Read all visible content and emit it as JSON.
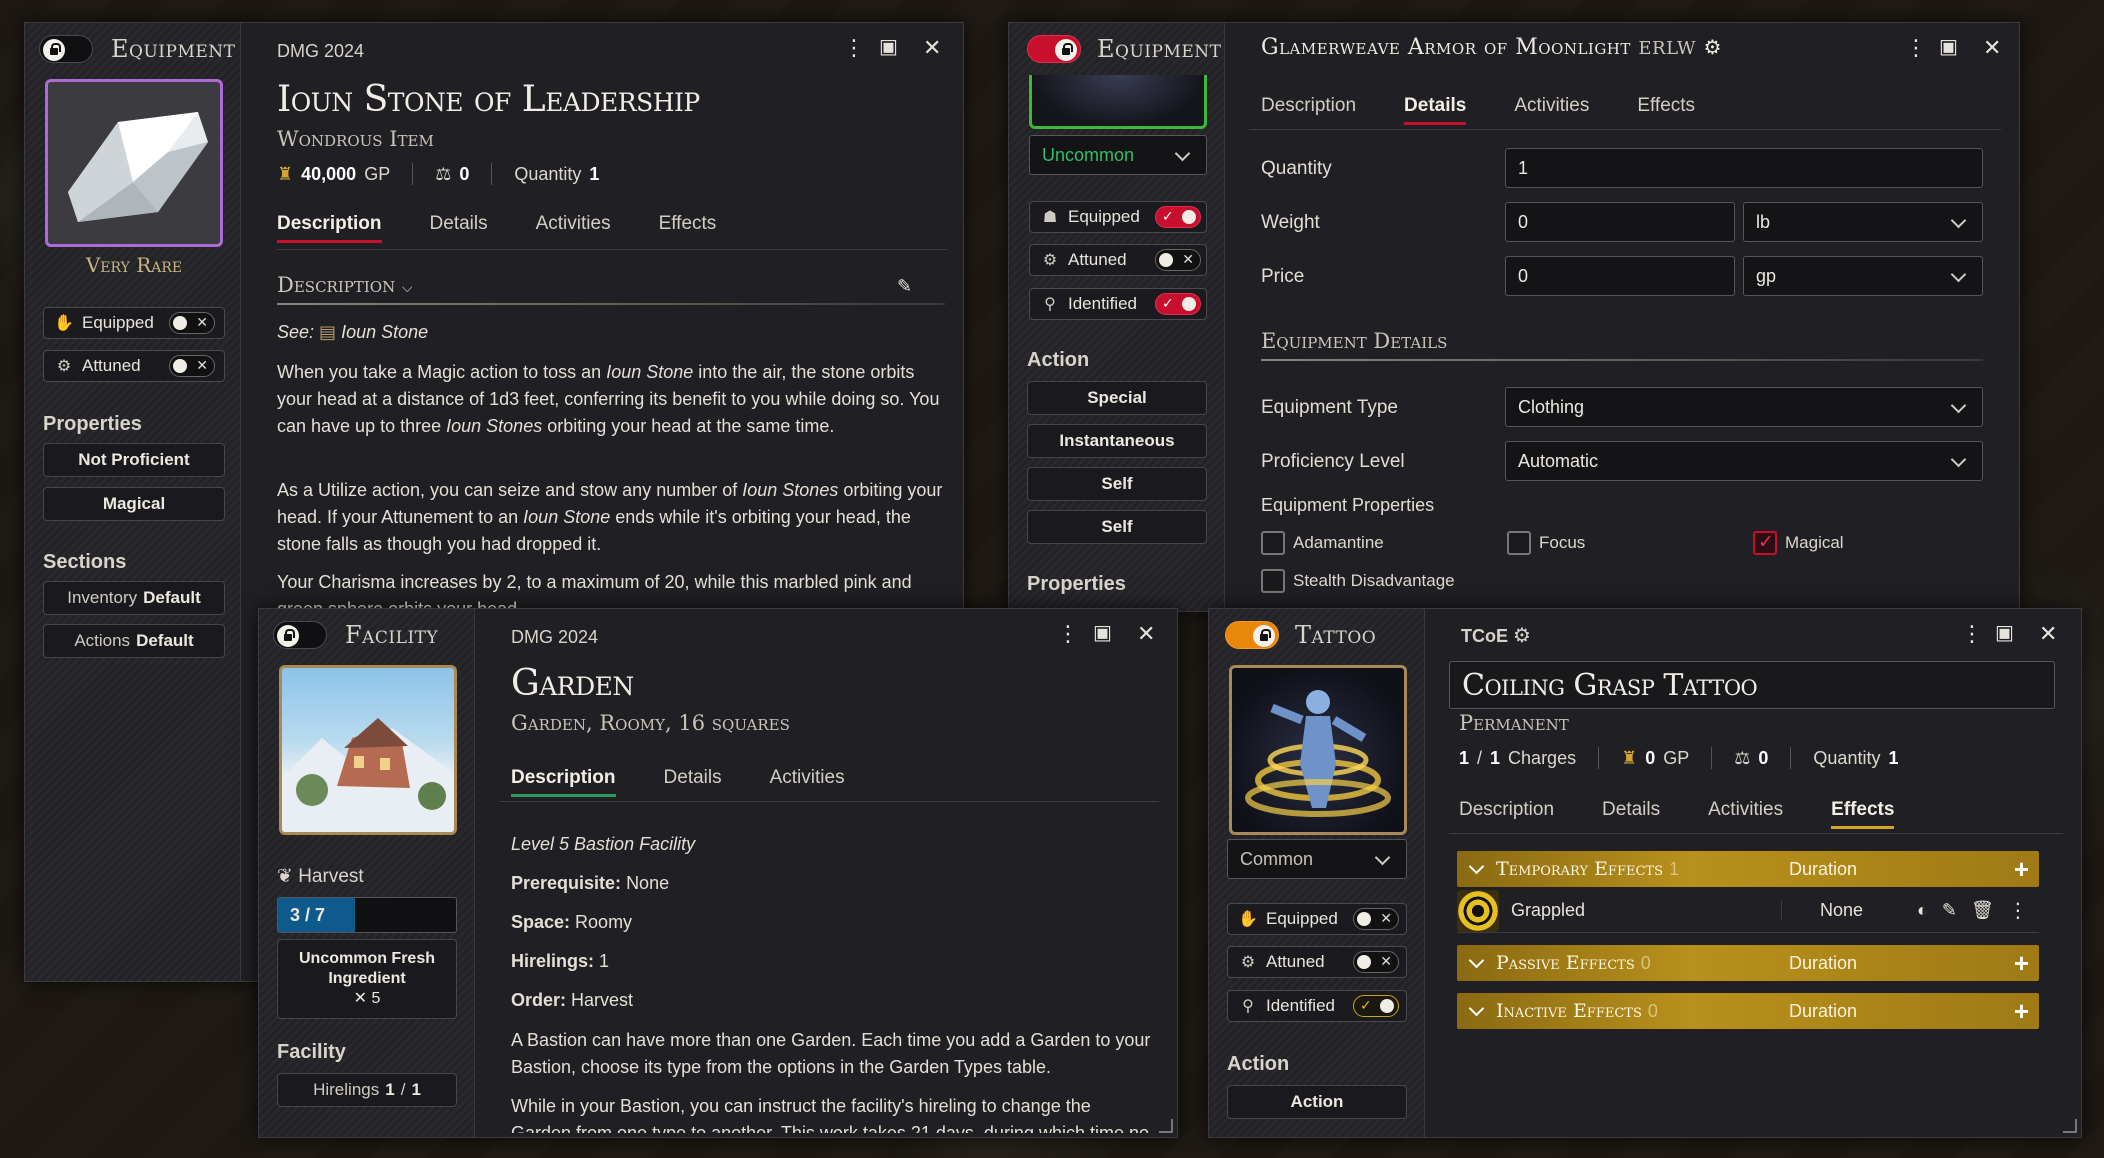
{
  "win1": {
    "type_label": "Equipment",
    "source": "DMG 2024",
    "title": "Ioun Stone of Leadership",
    "subtitle": "Wondrous Item",
    "price": "40,000",
    "price_unit": "GP",
    "weight": "0",
    "quantity_label": "Quantity",
    "quantity": "1",
    "rarity": "Very Rare",
    "equipped_label": "Equipped",
    "attuned_label": "Attuned",
    "properties_heading": "Properties",
    "properties": [
      "Not Proficient",
      "Magical"
    ],
    "sections_heading": "Sections",
    "sections": [
      {
        "name": "Inventory",
        "value": "Default"
      },
      {
        "name": "Actions",
        "value": "Default"
      }
    ],
    "tabs": [
      "Description",
      "Details",
      "Activities",
      "Effects"
    ],
    "active_tab": "Description",
    "desc_heading": "Description",
    "see_label": "See:",
    "see_link": "Ioun Stone",
    "paragraphs": {
      "p1a": "When you take a Magic action to toss an ",
      "p1b": "Ioun Stone",
      "p1c": " into the air, the stone orbits your head at a distance of 1d3 feet, conferring its benefit to you while doing so. You can have up to three ",
      "p1d": "Ioun Stones",
      "p1e": " orbiting your head at the same time.",
      "p2a": "As a Utilize action, you can seize and stow any number of ",
      "p2b": "Ioun Stones",
      "p2c": " orbiting your head. If your Attunement to an ",
      "p2d": "Ioun Stone",
      "p2e": " ends while it's orbiting your head, the stone falls as though you had dropped it.",
      "p3": "Your Charisma increases by 2, to a maximum of 20, while this marbled pink and green sphere orbits your head."
    }
  },
  "win2": {
    "type_label": "Equipment",
    "title": "Glamerweave Armor of Moonlight",
    "source": "ERLW",
    "rarity_select": "Uncommon",
    "equipped_label": "Equipped",
    "attuned_label": "Attuned",
    "identified_label": "Identified",
    "action_heading": "Action",
    "action_buttons": [
      "Special",
      "Instantaneous",
      "Self",
      "Self"
    ],
    "properties_heading": "Properties",
    "tabs": [
      "Description",
      "Details",
      "Activities",
      "Effects"
    ],
    "active_tab": "Details",
    "quantity_label": "Quantity",
    "quantity": "1",
    "weight_label": "Weight",
    "weight": "0",
    "weight_unit": "lb",
    "price_label": "Price",
    "price": "0",
    "price_unit": "gp",
    "details_heading": "Equipment Details",
    "equip_type_label": "Equipment Type",
    "equip_type": "Clothing",
    "prof_label": "Proficiency Level",
    "prof": "Automatic",
    "equip_props_label": "Equipment Properties",
    "checkboxes": [
      {
        "label": "Adamantine",
        "checked": false
      },
      {
        "label": "Focus",
        "checked": false
      },
      {
        "label": "Magical",
        "checked": true
      },
      {
        "label": "Stealth Disadvantage",
        "checked": false
      }
    ]
  },
  "win3": {
    "type_label": "Facility",
    "source": "DMG 2024",
    "title": "Garden",
    "subtitle": "Garden, Roomy, 16 squares",
    "harvest_label": "Harvest",
    "harvest_value": "3 / 7",
    "harvest_fraction": 0.43,
    "ingredient": "Uncommon Fresh Ingredient",
    "ingredient_qty": "✕ 5",
    "facility_heading": "Facility",
    "hirelings_label": "Hirelings",
    "hirelings_value": "1",
    "hirelings_max": "1",
    "tabs": [
      "Description",
      "Details",
      "Activities"
    ],
    "active_tab": "Description",
    "level": "Level 5 Bastion Facility",
    "facts": [
      {
        "k": "Prerequisite:",
        "v": "None"
      },
      {
        "k": "Space:",
        "v": "Roomy"
      },
      {
        "k": "Hirelings:",
        "v": "1"
      },
      {
        "k": "Order:",
        "v": "Harvest"
      }
    ],
    "para1": "A Bastion can have more than one Garden. Each time you add a Garden to your Bastion, choose its type from the options in the Garden Types table.",
    "para2": "While in your Bastion, you can instruct the facility's hireling to change the Garden from one type to another. This work takes 21 days, during which time no other"
  },
  "win4": {
    "type_label": "Tattoo",
    "source": "TCoE",
    "title": "Coiling Grasp Tattoo",
    "subtitle": "Permanent",
    "charges_value": "1",
    "charges_max": "1",
    "charges_label": "Charges",
    "price": "0",
    "price_unit": "GP",
    "weight": "0",
    "quantity_label": "Quantity",
    "quantity": "1",
    "rarity_select": "Common",
    "equipped_label": "Equipped",
    "attuned_label": "Attuned",
    "identified_label": "Identified",
    "action_heading": "Action",
    "action_button": "Action",
    "tabs": [
      "Description",
      "Details",
      "Activities",
      "Effects"
    ],
    "active_tab": "Effects",
    "duration_label": "Duration",
    "groups": [
      {
        "name": "Temporary Effects",
        "count": "1"
      },
      {
        "name": "Passive Effects",
        "count": "0"
      },
      {
        "name": "Inactive Effects",
        "count": "0"
      }
    ],
    "effect": {
      "name": "Grappled",
      "duration": "None"
    }
  },
  "colors": {
    "accent_red": "#c8102e",
    "accent_green": "#2e9a5a",
    "accent_gold": "#d5a524",
    "rarity_purple": "#b06ad8"
  }
}
